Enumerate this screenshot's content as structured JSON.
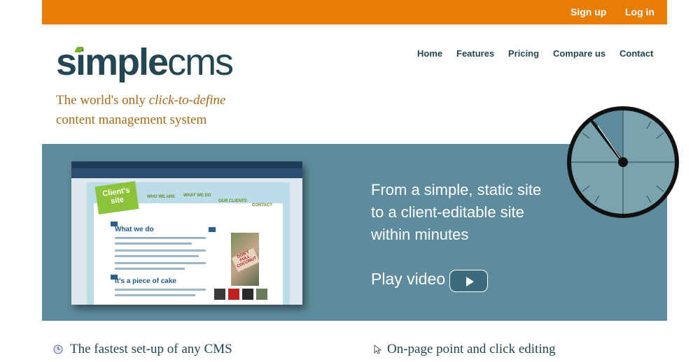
{
  "header": {
    "signup_label": "Sign up",
    "login_label": "Log in",
    "brand_color": "#e87d05"
  },
  "logo": {
    "part1": "simple",
    "part2": "cms"
  },
  "nav": {
    "items": [
      {
        "label": "Home"
      },
      {
        "label": "Features"
      },
      {
        "label": "Pricing"
      },
      {
        "label": "Compare us"
      },
      {
        "label": "Contact"
      }
    ]
  },
  "tagline": {
    "line1_pre": "The world's only ",
    "line1_em": "click-to-define",
    "line2": "content management system"
  },
  "hero": {
    "line1": "From a simple, static site",
    "line2": "to a client-editable site",
    "line3": "within minutes",
    "play_label": "Play video",
    "bg_color": "#5e8c9c"
  },
  "screenshot": {
    "brand_label": "Client's site",
    "menu": [
      "WHO WE ARE",
      "WHAT WE DO",
      "OUR CLIENTS",
      "CONTACT"
    ],
    "heading1": "What we do",
    "heading2": "It's a piece of cake",
    "sign_text": "DON'T FULL COCONUT"
  },
  "features": {
    "left": "The fastest set-up of any CMS",
    "right": "On-page point and click editing"
  }
}
